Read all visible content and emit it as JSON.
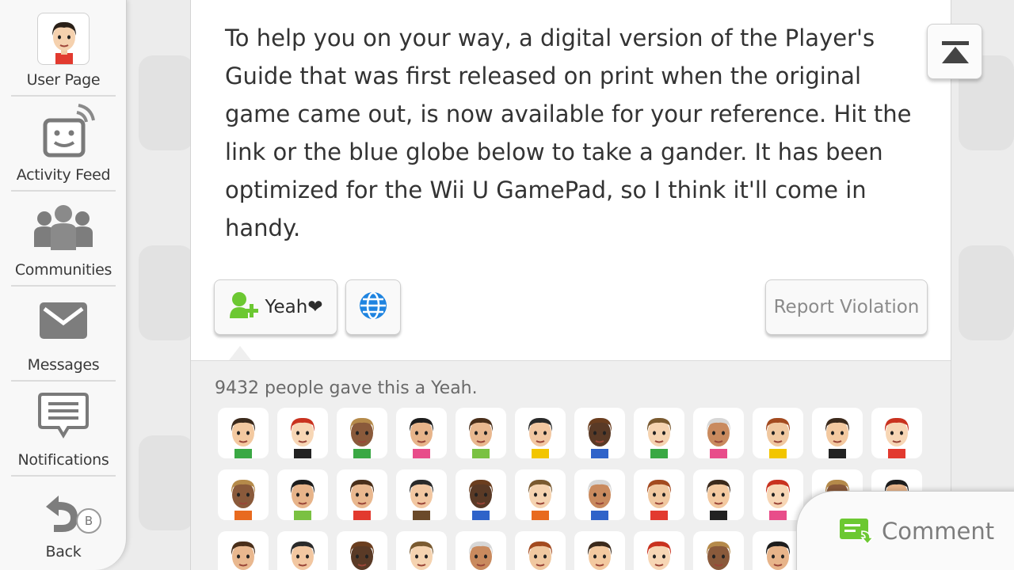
{
  "sidebar": {
    "items": [
      {
        "label": "User Page",
        "icon": "user-avatar"
      },
      {
        "label": "Activity Feed",
        "icon": "activity-feed-icon"
      },
      {
        "label": "Communities",
        "icon": "communities-icon"
      },
      {
        "label": "Messages",
        "icon": "envelope-icon"
      },
      {
        "label": "Notifications",
        "icon": "notifications-icon"
      },
      {
        "label": "Back",
        "icon": "back-arrow-icon",
        "badge": "B"
      }
    ]
  },
  "post": {
    "body": "To help you on your way, a digital version of the Player's Guide that was first released on print when the original game came out, is now available for your reference. Hit the link or the blue globe below to take a gander. It has been optimized for the Wii U GamePad, so I think it'll come in handy."
  },
  "actions": {
    "yeah_label": "Yeah❤",
    "report_label": "Report Violation"
  },
  "yeahs": {
    "count_text": "9432 people gave this a Yeah."
  },
  "comment": {
    "label": "Comment"
  },
  "colors": {
    "accent_green": "#6cc832",
    "globe_blue": "#1f84e0"
  }
}
